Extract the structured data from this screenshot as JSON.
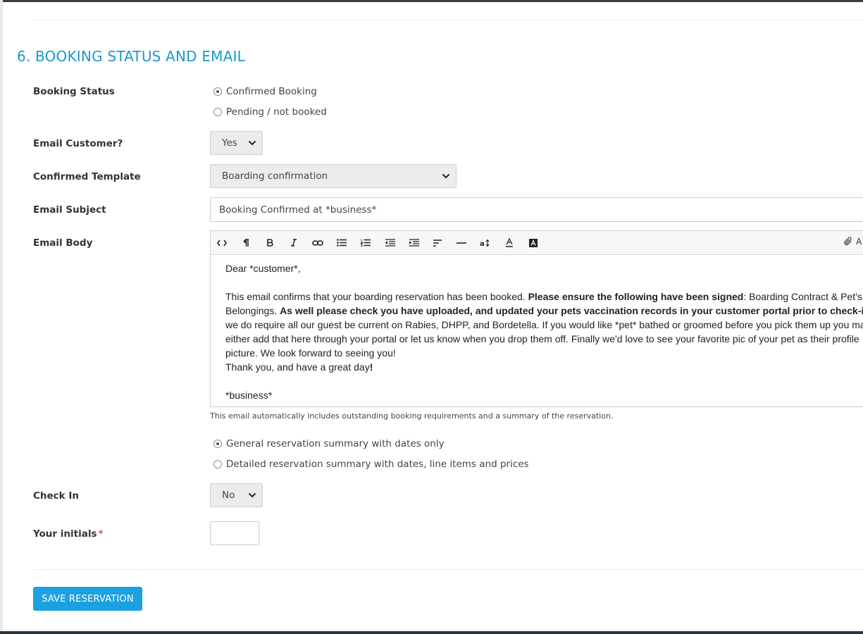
{
  "section": {
    "title": "6. BOOKING STATUS AND EMAIL"
  },
  "booking_status": {
    "label": "Booking Status",
    "options": [
      "Confirmed Booking",
      "Pending / not booked"
    ],
    "selected": "Confirmed Booking"
  },
  "email_customer": {
    "label": "Email Customer?",
    "value": "Yes"
  },
  "confirmed_template": {
    "label": "Confirmed Template",
    "value": "Boarding confirmation"
  },
  "email_subject": {
    "label": "Email Subject",
    "value": "Booking Confirmed at *business*"
  },
  "email_body": {
    "label": "Email Body",
    "toolbar": {
      "attach_label": "A",
      "buttons": [
        "code",
        "paragraph",
        "bold",
        "italic",
        "link",
        "unordered-list",
        "ordered-list",
        "outdent",
        "indent",
        "align",
        "horizontal-rule",
        "font-size",
        "font-color",
        "background-color"
      ]
    },
    "greeting": "Dear *customer*,",
    "para_seg1": "This email confirms that your boarding reservation has been booked. ",
    "para_bold1": "Please ensure the following have been signed",
    "para_seg2": ": Boarding Contract & Pet's",
    "line2_seg1": "Belongings. ",
    "line2_bold": "As well please check you have uploaded, and updated your pets vaccination records in your customer portal prior to check-i",
    "line3": "we do require all our guest be current on Rabies, DHPP, and Bordetella. If you would like *pet* bathed or groomed before you pick them up you ma",
    "line4": "either add that here through your portal or let us know when you drop them off. Finally we'd love to see your favorite pic of your pet as their profile",
    "line5": "picture. We look forward to seeing you!",
    "thanks": "Thank you, and have a great day",
    "thanks_bang": "!",
    "signoff": "*business*"
  },
  "helper_text": "This email automatically includes outstanding booking requirements and a summary of the reservation.",
  "summary_options": {
    "options": [
      "General reservation summary with dates only",
      "Detailed reservation summary with dates, line items and prices"
    ],
    "selected": "General reservation summary with dates only"
  },
  "check_in": {
    "label": "Check In",
    "value": "No"
  },
  "initials": {
    "label": "Your initials",
    "required_mark": "*",
    "value": ""
  },
  "save_button": {
    "label": "SAVE RESERVATION"
  },
  "colors": {
    "accent": "#1a96d4",
    "button": "#1ba1e2",
    "required": "#d9534f"
  }
}
